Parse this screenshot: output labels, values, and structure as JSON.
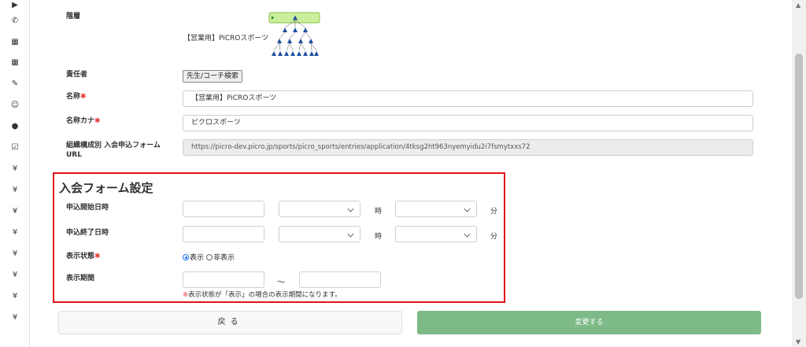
{
  "sidebar": {
    "icons": [
      "play-icon",
      "phone-icon",
      "calendar-icon",
      "calendar-icon",
      "pencil-icon",
      "smile-icon",
      "user-icon",
      "check-square-icon",
      "yen-icon",
      "yen-icon",
      "yen-icon",
      "yen-icon",
      "yen-icon",
      "yen-icon",
      "yen-icon",
      "yen-icon"
    ],
    "glyphs": [
      "▶",
      "✆",
      "▦",
      "▦",
      "✎",
      "☺",
      "●",
      "☑",
      "¥",
      "¥",
      "¥",
      "¥",
      "¥",
      "¥",
      "¥",
      "¥"
    ]
  },
  "form": {
    "hierarchy": {
      "label": "階層",
      "value": "【営業用】PiCROスポーツ"
    },
    "responsible": {
      "label": "責任者",
      "button": "先生/コーチ検索"
    },
    "name": {
      "label": "名称",
      "required": "✱",
      "value": "【営業用】PiCROスポーツ"
    },
    "kana": {
      "label": "名称カナ",
      "required": "✱",
      "value": "ピクロスポーツ"
    },
    "url": {
      "label1": "組織構成別 入会申込フォーム",
      "label2": "URL",
      "value": "https://picro-dev.picro.jp/sports/picro_sports/entries/application/4tksg2ht963nyemyidu2i7fsmytxxs72"
    }
  },
  "section": {
    "title": "入会フォーム設定",
    "start": {
      "label": "申込開始日時",
      "hour_unit": "時",
      "minute_unit": "分"
    },
    "end": {
      "label": "申込終了日時",
      "hour_unit": "時",
      "minute_unit": "分"
    },
    "display": {
      "label": "表示状態",
      "required": "✱",
      "options": [
        "表示",
        "非表示"
      ],
      "selected": "表示"
    },
    "period": {
      "label": "表示期間",
      "separator": "～",
      "note_mark": "※",
      "note": "表示状態が「表示」の場合の表示期間になります。"
    }
  },
  "buttons": {
    "back": "戻る",
    "save": "変更する"
  },
  "colors": {
    "accent": "#e0131a",
    "save": "#7dba87",
    "tree": "#1f4e9c",
    "tree_root_bg": "#c9ef9c"
  }
}
